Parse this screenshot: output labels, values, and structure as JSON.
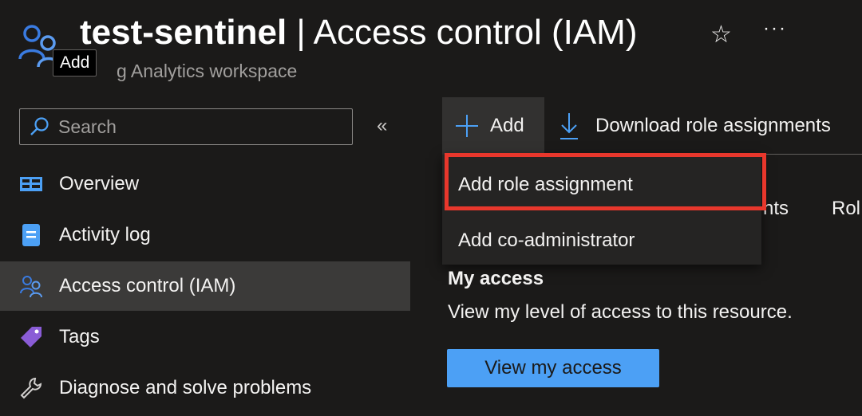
{
  "header": {
    "resource_name": "test-sentinel",
    "separator": " | ",
    "page_name": "Access control (IAM)",
    "subtitle": "g Analytics workspace",
    "star_icon": "☆",
    "more_icon": "···",
    "title_icon": "people-icon"
  },
  "tooltip": {
    "text": "Add"
  },
  "sidebar": {
    "search_placeholder": "Search",
    "collapse_icon": "«",
    "items": [
      {
        "label": "Overview",
        "icon": "overview-icon"
      },
      {
        "label": "Activity log",
        "icon": "activity-log-icon"
      },
      {
        "label": "Access control (IAM)",
        "icon": "people-icon",
        "active": true
      },
      {
        "label": "Tags",
        "icon": "tag-icon"
      },
      {
        "label": "Diagnose and solve problems",
        "icon": "wrench-icon"
      }
    ]
  },
  "toolbar": {
    "add_label": "Add",
    "download_label": "Download role assignments"
  },
  "dropdown": {
    "items": [
      {
        "label": "Add role assignment",
        "highlighted": true
      },
      {
        "label": "Add co-administrator"
      }
    ]
  },
  "tabs_fragment": {
    "left": "nts",
    "right": "Rol"
  },
  "my_access": {
    "title": "My access",
    "description": "View my level of access to this resource.",
    "button_label": "View my access"
  },
  "colors": {
    "background": "#1b1a19",
    "accent": "#4ca0f5",
    "highlight": "#e8372c",
    "active_nav": "#3b3a39"
  }
}
